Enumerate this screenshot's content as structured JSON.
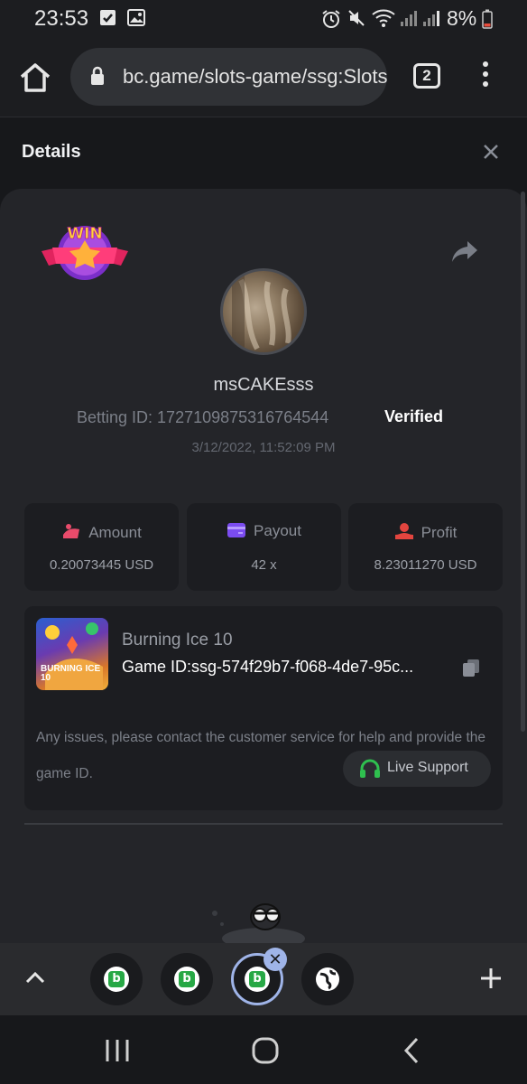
{
  "status_bar": {
    "time": "23:53",
    "battery": "8%",
    "icons": [
      "check-notification-icon",
      "image-notification-icon",
      "alarm-icon",
      "mute-icon",
      "wifi-icon",
      "signal-icon",
      "signal-icon",
      "battery-low-icon"
    ]
  },
  "browser": {
    "url": "bc.game/slots-game/ssg:Slots",
    "tab_count": "2"
  },
  "details": {
    "title": "Details",
    "username": "msCAKEsss",
    "betting_id": "Betting ID: 1727109875316764544",
    "verified": "Verified",
    "datetime": "3/12/2022, 11:52:09 PM",
    "badge": "WIN",
    "stats": {
      "amount": {
        "label": "Amount",
        "value": "0.20073445 USD"
      },
      "payout": {
        "label": "Payout",
        "value": "42 x"
      },
      "profit": {
        "label": "Profit",
        "value": "8.23011270 USD"
      }
    },
    "game": {
      "name": "Burning Ice 10",
      "game_id": "Game ID:ssg-574f29b7-f068-4de7-95c...",
      "thumb_title": "BURNING ICE 10"
    },
    "help_text": "Any issues, please contact the customer service for help and provide the game ID.",
    "live_support": "Live Support"
  },
  "colors": {
    "accent_green": "#27a845",
    "verified": "#ffffff",
    "active_tab": "#9fb4e8"
  }
}
